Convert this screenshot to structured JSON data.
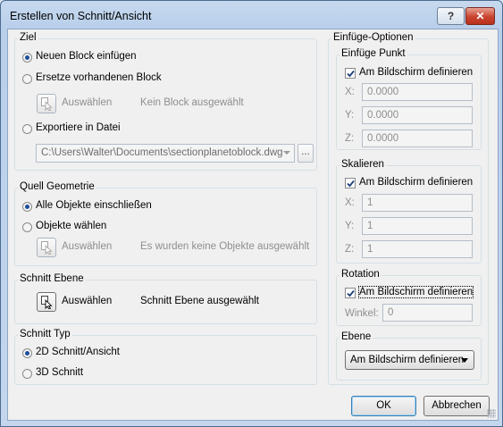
{
  "window": {
    "title": "Erstellen von Schnitt/Ansicht",
    "help_label": "?",
    "close_label": "✕"
  },
  "ziel": {
    "label": "Ziel",
    "option_new_block": "Neuen Block einfügen",
    "option_replace_block": "Ersetze vorhandenen Block",
    "select_label": "Auswählen",
    "status": "Kein Block ausgewählt",
    "option_export": "Exportiere in Datei",
    "file_path": "C:\\Users\\Walter\\Documents\\sectionplanetoblock.dwg",
    "browse_label": "...",
    "selected_option": "option_new_block"
  },
  "quell": {
    "label": "Quell Geometrie",
    "option_all": "Alle Objekte einschließen",
    "option_select": "Objekte wählen",
    "select_label": "Auswählen",
    "status": "Es wurden keine Objekte ausgewählt",
    "selected_option": "option_all"
  },
  "schnitt_ebene": {
    "label": "Schnitt Ebene",
    "select_label": "Auswählen",
    "status": "Schnitt Ebene ausgewählt"
  },
  "schnitt_typ": {
    "label": "Schnitt Typ",
    "option_2d": "2D Schnitt/Ansicht",
    "option_3d": "3D Schnitt",
    "selected_option": "option_2d"
  },
  "einfuege": {
    "label": "Einfüge-Optionen",
    "punkt": {
      "label": "Einfüge Punkt",
      "checkbox_label": "Am Bildschirm definieren",
      "checked": true,
      "x_label": "X:",
      "x_value": "0.0000",
      "y_label": "Y:",
      "y_value": "0.0000",
      "z_label": "Z:",
      "z_value": "0.0000"
    },
    "skalieren": {
      "label": "Skalieren",
      "checkbox_label": "Am Bildschirm definieren",
      "checked": true,
      "x_label": "X:",
      "x_value": "1",
      "y_label": "Y:",
      "y_value": "1",
      "z_label": "Z:",
      "z_value": "1"
    },
    "rotation": {
      "label": "Rotation",
      "checkbox_label": "Am Bildschirm definieren",
      "checked": true,
      "winkel_label": "Winkel:",
      "winkel_value": "0"
    },
    "ebene": {
      "label": "Ebene",
      "selected": "Am Bildschirm definieren"
    }
  },
  "footer": {
    "ok_label": "OK",
    "cancel_label": "Abbrechen"
  },
  "colors": {
    "accent": "#1c4f9c",
    "title_bar": "#c6d9ef",
    "client_bg": "#f0f0f0",
    "close_button": "#c9432f"
  }
}
